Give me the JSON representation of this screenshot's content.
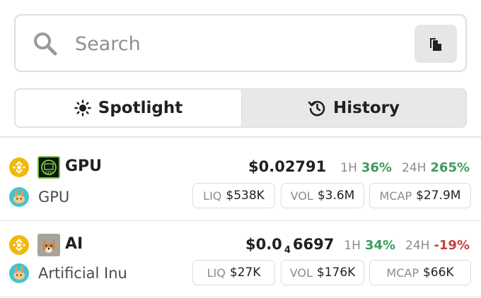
{
  "search": {
    "placeholder": "Search",
    "value": "",
    "search_icon": "search-icon",
    "paste_icon": "clipboard-icon"
  },
  "tabs": [
    {
      "label": "Spotlight",
      "icon": "sun-icon",
      "active": true
    },
    {
      "label": "History",
      "icon": "history-icon",
      "active": false
    }
  ],
  "tokens": [
    {
      "symbol": "GPU",
      "name": "GPU",
      "chain_icon": "bnb-chain-icon",
      "dex_icon": "pancakeswap-icon",
      "logo_text": "GPU",
      "price_prefix": "$0.02791",
      "price_sub": "",
      "price_suffix": "",
      "h1_label": "1H",
      "h1_value": "36%",
      "h1_trend": "pos",
      "h24_label": "24H",
      "h24_value": "265%",
      "h24_trend": "pos",
      "liq_label": "LIQ",
      "liq_value": "$538K",
      "vol_label": "VOL",
      "vol_value": "$3.6M",
      "mcap_label": "MCAP",
      "mcap_value": "$27.9M"
    },
    {
      "symbol": "AI",
      "name": "Artificial Inu",
      "chain_icon": "bnb-chain-icon",
      "dex_icon": "pancakeswap-icon",
      "logo_text": "",
      "price_prefix": "$0.0",
      "price_sub": "4",
      "price_suffix": "6697",
      "h1_label": "1H",
      "h1_value": "34%",
      "h1_trend": "pos",
      "h24_label": "24H",
      "h24_value": "-19%",
      "h24_trend": "neg",
      "liq_label": "LIQ",
      "liq_value": "$27K",
      "vol_label": "VOL",
      "vol_value": "$176K",
      "mcap_label": "MCAP",
      "mcap_value": "$66K"
    }
  ],
  "colors": {
    "positive": "#3d9b5b",
    "negative": "#c7403f",
    "bnb": "#f0b90b",
    "pancake": "#46c2cf"
  }
}
